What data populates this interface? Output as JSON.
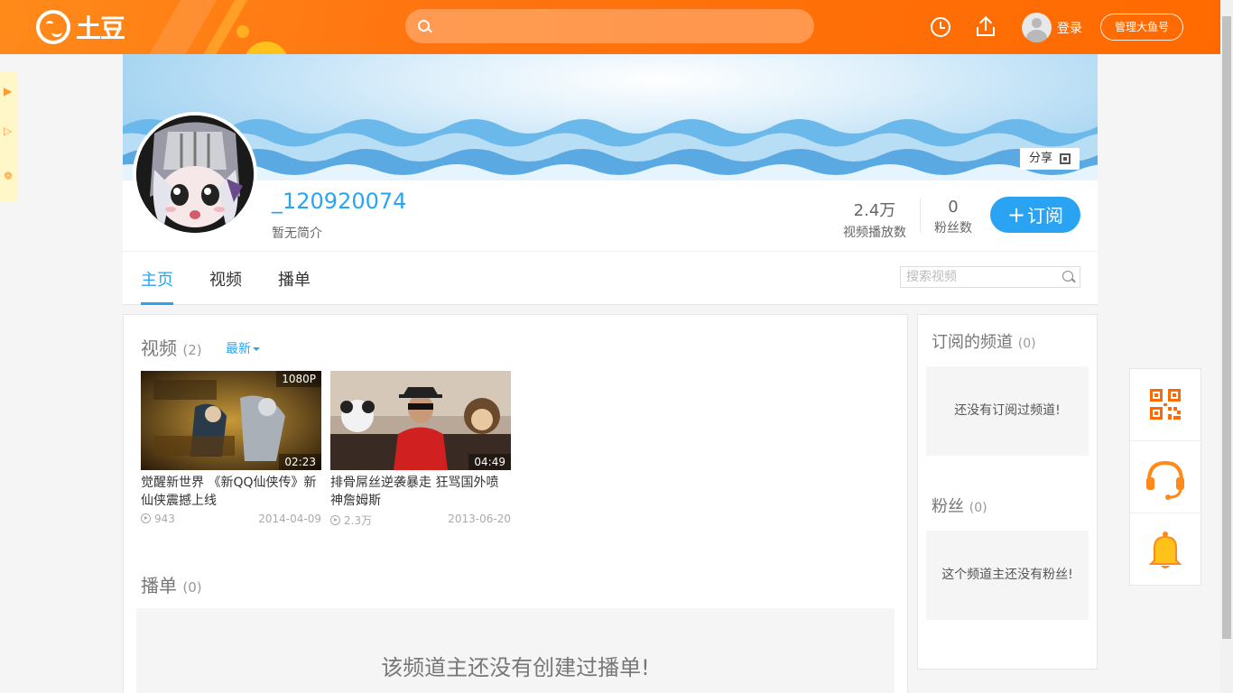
{
  "header": {
    "logo_text": "土豆",
    "search_placeholder": "",
    "login_label": "登录",
    "manage_label": "管理大鱼号",
    "icons": [
      "history-clock-icon",
      "upload-icon",
      "user-avatar-icon"
    ],
    "accent": "#ff6a00"
  },
  "left_tab": {
    "icons": [
      "play-triangle-icon",
      "play-outline-icon",
      "flower-icon"
    ]
  },
  "banner": {
    "share_label": "分享"
  },
  "channel": {
    "name": "_120920074",
    "description": "暂无简介",
    "stats": [
      {
        "value": "2.4万",
        "label": "视频播放数"
      },
      {
        "value": "0",
        "label": "粉丝数"
      }
    ],
    "subscribe_label": "订阅",
    "subscribe_plus": "+",
    "accent": "#2aa4f2"
  },
  "nav": {
    "tabs": [
      {
        "label": "主页",
        "active": true
      },
      {
        "label": "视频",
        "active": false
      },
      {
        "label": "播单",
        "active": false
      }
    ],
    "search_placeholder": "搜索视频"
  },
  "videos_section": {
    "title": "视频",
    "count": "(2)",
    "sort_label": "最新",
    "items": [
      {
        "title": "觉醒新世界 《新QQ仙侠传》新仙侠震撼上线",
        "badge": "1080P",
        "duration": "02:23",
        "views": "943",
        "date": "2014-04-09"
      },
      {
        "title": "排骨屌丝逆袭暴走 狂骂国外喷神詹姆斯",
        "badge": "",
        "duration": "04:49",
        "views": "2.3万",
        "date": "2013-06-20"
      }
    ]
  },
  "playlists_section": {
    "title": "播单",
    "count": "(0)",
    "empty_text": "该频道主还没有创建过播单!"
  },
  "sidebar": {
    "subscribed": {
      "title": "订阅的频道",
      "count": "(0)",
      "empty_text": "还没有订阅过频道!"
    },
    "fans": {
      "title": "粉丝",
      "count": "(0)",
      "empty_text": "这个频道主还没有粉丝!"
    }
  },
  "tools": {
    "icons": [
      "qr-code-icon",
      "customer-service-headset-icon",
      "notification-bell-icon"
    ]
  }
}
